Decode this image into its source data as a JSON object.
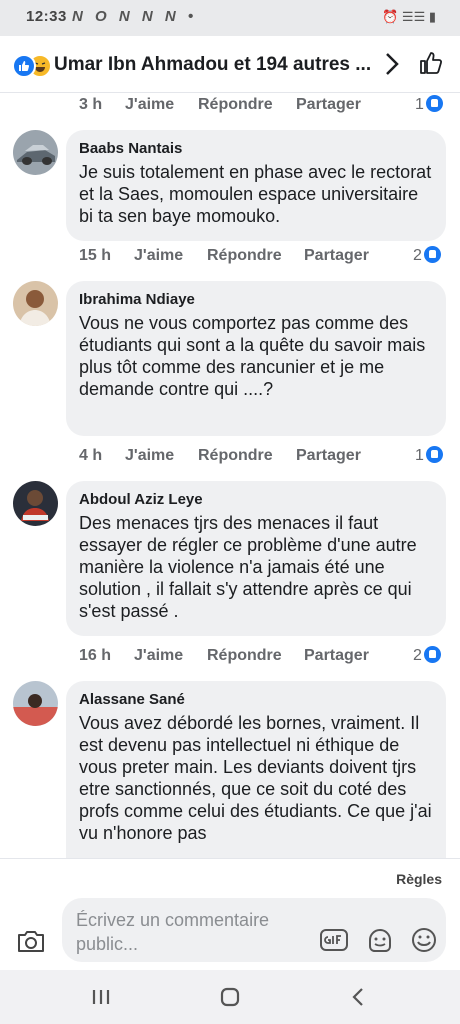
{
  "status_bar": {
    "time": "12:33",
    "notif_icons": "N O N N N •",
    "system_icons": "⏰ ☰☰ ▮"
  },
  "header": {
    "title": "Umar Ibn Ahmadou et 194 autres ..."
  },
  "actions": {
    "like": "J'aime",
    "reply": "Répondre",
    "share": "Partager"
  },
  "top_row": {
    "time": "3 h",
    "likes": "1"
  },
  "comments": [
    {
      "author": "Baabs Nantais",
      "text": "Je suis totalement en phase avec le rectorat et la Saes, momoulen espace universitaire bi ta sen baye momouko.",
      "time": "15 h",
      "likes": "2"
    },
    {
      "author": "Ibrahima Ndiaye",
      "text": "Vous ne vous comportez pas comme des étudiants qui sont a la quête du savoir mais plus tôt comme des rancunier et je me demande contre qui ....?",
      "time": "4 h",
      "likes": "1"
    },
    {
      "author": "Abdoul Aziz Leye",
      "text": "Des menaces tjrs des menaces il faut essayer de régler ce problème d'une autre manière la violence n'a jamais été une solution , il fallait s'y attendre après ce qui s'est passé .",
      "time": "16 h",
      "likes": "2"
    },
    {
      "author": "Alassane Sané",
      "text": "Vous avez débordé les bornes, vraiment. Il est devenu pas intellectuel ni éthique de vous preter main. Les deviants doivent tjrs etre sanctionnés, que ce soit du coté des profs comme celui des étudiants. Ce que j'ai vu n'honore pas"
    }
  ],
  "sort_label": "Règles",
  "composer": {
    "placeholder": "Écrivez un commentaire public..."
  },
  "colors": {
    "accent": "#1877f2",
    "bubble": "#eff0f2",
    "meta": "#65676b",
    "haha": "#f7b928"
  },
  "icons": [
    "like-reaction-icon",
    "haha-reaction-icon",
    "chevron-right-icon",
    "thumbs-up-icon",
    "camera-icon",
    "gif-icon",
    "sticker-icon",
    "emoji-icon",
    "recent-apps-icon",
    "home-icon",
    "back-icon"
  ]
}
